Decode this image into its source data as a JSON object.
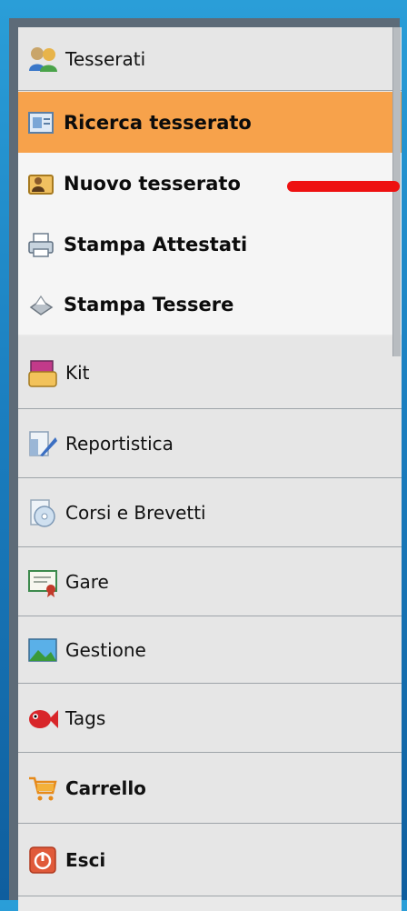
{
  "menu": {
    "header": {
      "label": "Tesserati",
      "icon": "users-icon"
    },
    "subitems": [
      {
        "label": "Ricerca tesserato",
        "icon": "search-card-icon",
        "active": true
      },
      {
        "label": "Nuovo tesserato",
        "icon": "new-member-icon",
        "active": false
      },
      {
        "label": "Stampa Attestati",
        "icon": "printer-icon",
        "active": false
      },
      {
        "label": "Stampa Tessere",
        "icon": "printer-small-icon",
        "active": false
      }
    ],
    "sections": [
      {
        "label": "Kit",
        "icon": "kit-icon"
      },
      {
        "label": "Reportistica",
        "icon": "report-icon"
      },
      {
        "label": "Corsi e Brevetti",
        "icon": "cd-icon"
      },
      {
        "label": "Gare",
        "icon": "certificate-icon"
      },
      {
        "label": "Gestione",
        "icon": "image-icon"
      },
      {
        "label": "Tags",
        "icon": "fish-icon"
      },
      {
        "label": "Carrello",
        "icon": "cart-icon"
      },
      {
        "label": "Esci",
        "icon": "power-icon"
      }
    ]
  },
  "colors": {
    "active_bg": "#f7a24b",
    "background": "#1b7fc0",
    "annotation": "#ee1111"
  }
}
